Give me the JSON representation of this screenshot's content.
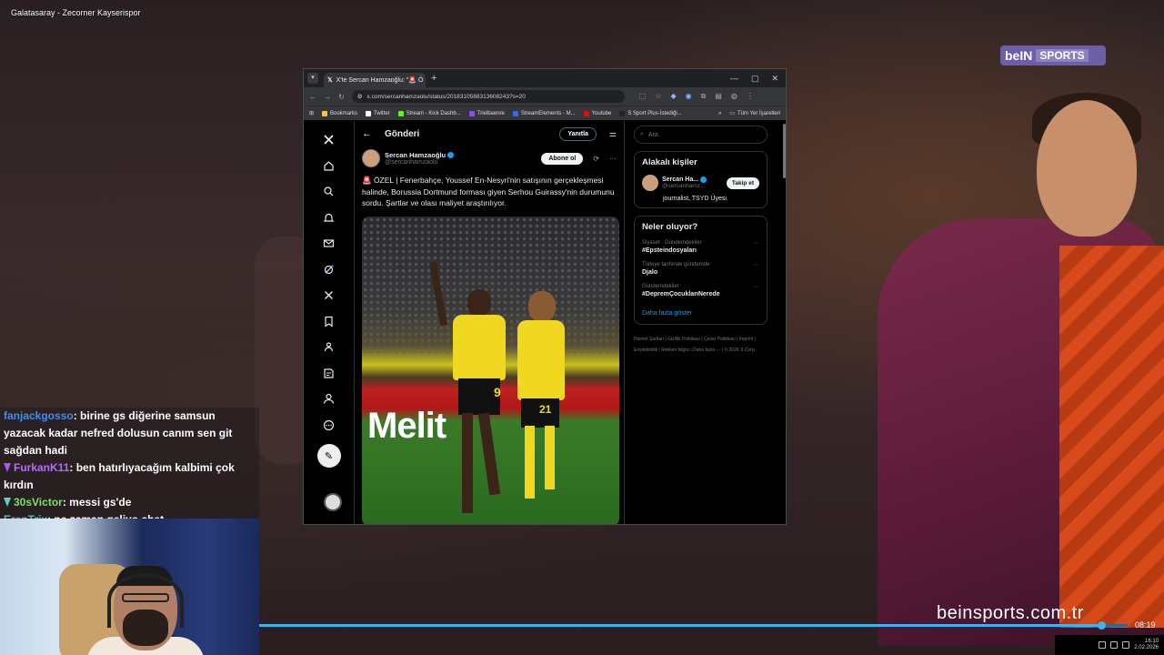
{
  "stream": {
    "title": "Galatasaray - Zecorner Kayserispor",
    "broadcaster_logo": "beIN",
    "broadcaster_logo_sports": "SPORTS",
    "broadcaster_url": "beinsports.com.tr",
    "progress_fraction": 0.97,
    "time_display": "08:19",
    "clock_time": "16:10",
    "clock_date": "2.02.2026"
  },
  "chat": [
    {
      "user": "fanjackgosso",
      "message": ": birine gs diğerine samsun yazacak kadar nefred dolusun canım sen git sağdan hadi",
      "user_color": "#3f8ef5",
      "badge": ""
    },
    {
      "user": "FurkanK11",
      "message": ": ben hatırlıyacağım kalbimi çok kırdın",
      "user_color": "#b56cff",
      "badge": "purple"
    },
    {
      "user": "30sVictor",
      "message": ": messi gs'de",
      "user_color": "#7be06b",
      "badge": "teal"
    },
    {
      "user": "ErenTrix",
      "message": ": ne zaman geliyo chat",
      "user_color": "#47c7b8",
      "badge": ""
    }
  ],
  "browser": {
    "tab_title": "X'te Sercan Hamzaoğlu: \"🚨 Ö",
    "tab_icon": "x-logo-icon",
    "url": "x.com/sercanhamzaolu/status/2018310588313608243?s=20",
    "window_controls": [
      "—",
      "▢",
      "✕"
    ],
    "bookmarks": [
      {
        "label": "Bookmarks",
        "color": "#f5c542"
      },
      {
        "label": "Twitter",
        "color": "#ffffff"
      },
      {
        "label": "Stream - Kick Dashb...",
        "color": "#53fc18"
      },
      {
        "label": "Trielbaenre",
        "color": "#9146ff"
      },
      {
        "label": "StreamElements - M...",
        "color": "#2b6cf0"
      },
      {
        "label": "Youtube",
        "color": "#ff0000"
      },
      {
        "label": "S Sport Plus-İstediği...",
        "color": "#222222"
      }
    ],
    "bookmarks_overflow": "»",
    "all_bookmarks": "Tüm Yer İşaretleri"
  },
  "x": {
    "header_title": "Gönderi",
    "reply_label": "Yanıtla",
    "author_name": "Sercan Hamzaoğlu",
    "author_handle": "@sercanhamzaolu",
    "subscribe_label": "Abone ol",
    "tweet_text": "🚨 ÖZEL | Fenerbahçe, Youssef En-Nesyri'nin satışının gerçekleşmesi halinde, Borussia Dortmund forması giyen Serhou Guirassy'nin durumunu sordu. Şartlar ve olası maliyet araştırılıyor.",
    "media_text": "Melit",
    "jersey_numbers": [
      "9",
      "21"
    ],
    "nav_icons": [
      "x-logo-icon",
      "home-icon",
      "search-icon",
      "bell-icon",
      "mail-icon",
      "grok-icon",
      "x-premium-icon",
      "bookmark-icon",
      "communities-icon",
      "premium-icon",
      "profile-icon",
      "more-icon"
    ],
    "search_placeholder": "Ara",
    "related_title": "Alakalı kişiler",
    "related": {
      "name": "Sercan Ha...",
      "handle": "@sercanhamz...",
      "follow_label": "Takip et",
      "bio": "journalist, TSYD Üyesi."
    },
    "whats_happening_title": "Neler oluyor?",
    "trends": [
      {
        "meta": "Siyaset · Gündemdekiler",
        "name": "#Epsteindosyaları"
      },
      {
        "meta": "Türkiye tarihinde gündemde",
        "name": "Djalo"
      },
      {
        "meta": "Gündemdekiler",
        "name": "#DepremÇocuklarıNerede"
      }
    ],
    "show_more": "Daha fazla göster",
    "footer_links": [
      "Hizmet Şartları",
      "Gizlilik Politikası",
      "Çerez Politikası",
      "Imprint",
      "Erişilebilirlik",
      "Reklam bilgisi",
      "Daha fazla ···",
      "© 2026 X Corp."
    ]
  }
}
